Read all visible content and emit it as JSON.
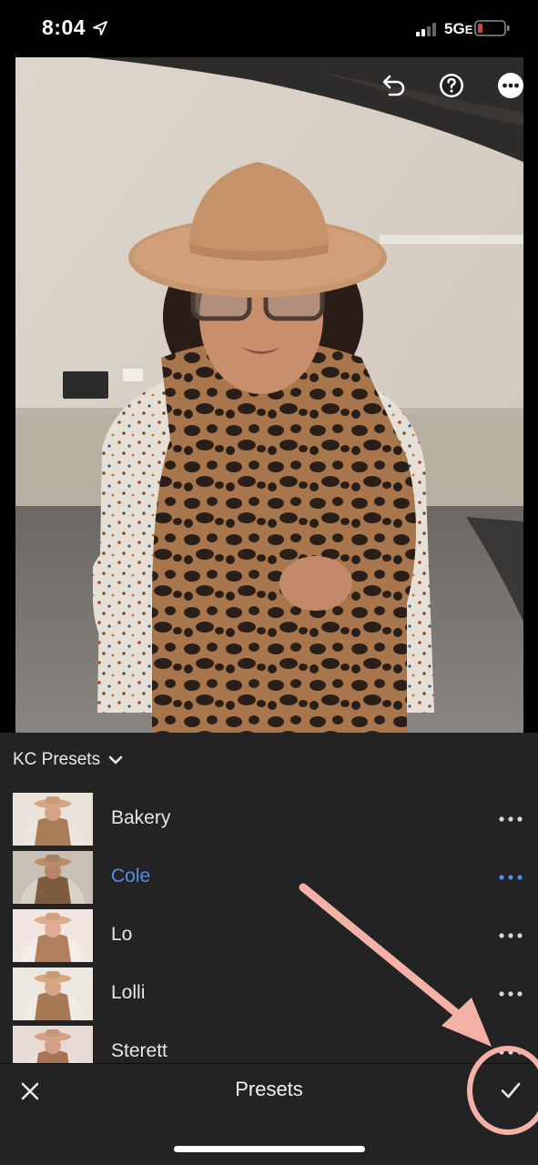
{
  "status_bar": {
    "time": "8:04",
    "network": "5G",
    "network_sub": "E",
    "battery_color": "#e23b3b"
  },
  "toolbar": {
    "icons": [
      "undo-icon",
      "help-icon",
      "more-icon"
    ]
  },
  "presets_panel": {
    "group_name": "KC Presets",
    "items": [
      {
        "label": "Bakery",
        "selected": false
      },
      {
        "label": "Cole",
        "selected": true
      },
      {
        "label": "Lo",
        "selected": false
      },
      {
        "label": "Lolli",
        "selected": false
      },
      {
        "label": "Sterett",
        "selected": false
      }
    ],
    "selected_color": "#4e8df2"
  },
  "bottom_bar": {
    "title": "Presets"
  },
  "annotation": {
    "color": "#f3b1a8"
  }
}
